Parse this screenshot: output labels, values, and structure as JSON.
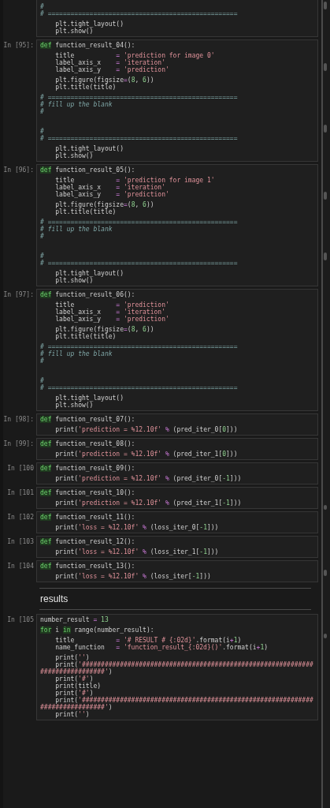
{
  "cells": [
    {
      "kind": "code",
      "cut_off_top": true,
      "lines": [
        {
          "kind": "code",
          "tokens": [
            {
              "kind": "comment",
              "text": "#"
            }
          ]
        },
        {
          "kind": "code",
          "tokens": [
            {
              "kind": "comment",
              "text": "# =================================================="
            }
          ]
        },
        {
          "kind": "blank"
        },
        {
          "kind": "code",
          "tokens": [
            {
              "kind": "plain",
              "text": "    plt.tight_layout()"
            }
          ]
        },
        {
          "kind": "code",
          "tokens": [
            {
              "kind": "plain",
              "text": "    plt.show()"
            }
          ]
        }
      ]
    },
    {
      "kind": "code",
      "cut_off_top": false,
      "prompt": "In [95]:",
      "lines": [
        {
          "kind": "code",
          "tokens": [
            {
              "kind": "keyword",
              "text": "def"
            },
            {
              "kind": "plain",
              "text": " function_result_04():"
            }
          ]
        },
        {
          "kind": "blank"
        },
        {
          "kind": "code",
          "tokens": [
            {
              "kind": "plain",
              "text": "    title           "
            },
            {
              "kind": "operator",
              "text": "= "
            },
            {
              "kind": "string",
              "text": "'prediction for image 0'"
            }
          ]
        },
        {
          "kind": "code",
          "tokens": [
            {
              "kind": "plain",
              "text": "    label_axis_x    "
            },
            {
              "kind": "operator",
              "text": "= "
            },
            {
              "kind": "string",
              "text": "'iteration'"
            }
          ]
        },
        {
          "kind": "code",
          "tokens": [
            {
              "kind": "plain",
              "text": "    label_axis_y    "
            },
            {
              "kind": "operator",
              "text": "= "
            },
            {
              "kind": "string",
              "text": "'prediction'"
            }
          ]
        },
        {
          "kind": "blank"
        },
        {
          "kind": "code",
          "tokens": [
            {
              "kind": "plain",
              "text": "    plt.figure(figsize"
            },
            {
              "kind": "operator",
              "text": "="
            },
            {
              "kind": "plain",
              "text": "("
            },
            {
              "kind": "number",
              "text": "8"
            },
            {
              "kind": "plain",
              "text": ", "
            },
            {
              "kind": "number",
              "text": "6"
            },
            {
              "kind": "plain",
              "text": "))"
            }
          ]
        },
        {
          "kind": "code",
          "tokens": [
            {
              "kind": "plain",
              "text": "    plt.title(title)"
            }
          ]
        },
        {
          "kind": "blank"
        },
        {
          "kind": "code",
          "tokens": [
            {
              "kind": "comment",
              "text": "# =================================================="
            }
          ]
        },
        {
          "kind": "code",
          "tokens": [
            {
              "kind": "comment",
              "text": "# fill up the blank"
            }
          ]
        },
        {
          "kind": "code",
          "tokens": [
            {
              "kind": "comment",
              "text": "#"
            }
          ]
        },
        {
          "kind": "blank"
        },
        {
          "kind": "blank"
        },
        {
          "kind": "blank"
        },
        {
          "kind": "blank"
        },
        {
          "kind": "code",
          "tokens": [
            {
              "kind": "comment",
              "text": "#"
            }
          ]
        },
        {
          "kind": "code",
          "tokens": [
            {
              "kind": "comment",
              "text": "# =================================================="
            }
          ]
        },
        {
          "kind": "blank"
        },
        {
          "kind": "code",
          "tokens": [
            {
              "kind": "plain",
              "text": "    plt.tight_layout()"
            }
          ]
        },
        {
          "kind": "code",
          "tokens": [
            {
              "kind": "plain",
              "text": "    plt.show()"
            }
          ]
        }
      ]
    },
    {
      "kind": "code",
      "cut_off_top": false,
      "prompt": "In [96]:",
      "lines": [
        {
          "kind": "code",
          "tokens": [
            {
              "kind": "keyword",
              "text": "def"
            },
            {
              "kind": "plain",
              "text": " function_result_05():"
            }
          ]
        },
        {
          "kind": "blank"
        },
        {
          "kind": "code",
          "tokens": [
            {
              "kind": "plain",
              "text": "    title           "
            },
            {
              "kind": "operator",
              "text": "= "
            },
            {
              "kind": "string",
              "text": "'prediction for image 1'"
            }
          ]
        },
        {
          "kind": "code",
          "tokens": [
            {
              "kind": "plain",
              "text": "    label_axis_x    "
            },
            {
              "kind": "operator",
              "text": "= "
            },
            {
              "kind": "string",
              "text": "'iteration'"
            }
          ]
        },
        {
          "kind": "code",
          "tokens": [
            {
              "kind": "plain",
              "text": "    label_axis_y    "
            },
            {
              "kind": "operator",
              "text": "= "
            },
            {
              "kind": "string",
              "text": "'prediction'"
            }
          ]
        },
        {
          "kind": "blank"
        },
        {
          "kind": "code",
          "tokens": [
            {
              "kind": "plain",
              "text": "    plt.figure(figsize"
            },
            {
              "kind": "operator",
              "text": "="
            },
            {
              "kind": "plain",
              "text": "("
            },
            {
              "kind": "number",
              "text": "8"
            },
            {
              "kind": "plain",
              "text": ", "
            },
            {
              "kind": "number",
              "text": "6"
            },
            {
              "kind": "plain",
              "text": "))"
            }
          ]
        },
        {
          "kind": "code",
          "tokens": [
            {
              "kind": "plain",
              "text": "    plt.title(title)"
            }
          ]
        },
        {
          "kind": "blank"
        },
        {
          "kind": "code",
          "tokens": [
            {
              "kind": "comment",
              "text": "# =================================================="
            }
          ]
        },
        {
          "kind": "code",
          "tokens": [
            {
              "kind": "comment",
              "text": "# fill up the blank"
            }
          ]
        },
        {
          "kind": "code",
          "tokens": [
            {
              "kind": "comment",
              "text": "#"
            }
          ]
        },
        {
          "kind": "blank"
        },
        {
          "kind": "blank"
        },
        {
          "kind": "blank"
        },
        {
          "kind": "blank"
        },
        {
          "kind": "code",
          "tokens": [
            {
              "kind": "comment",
              "text": "#"
            }
          ]
        },
        {
          "kind": "code",
          "tokens": [
            {
              "kind": "comment",
              "text": "# =================================================="
            }
          ]
        },
        {
          "kind": "blank"
        },
        {
          "kind": "code",
          "tokens": [
            {
              "kind": "plain",
              "text": "    plt.tight_layout()"
            }
          ]
        },
        {
          "kind": "code",
          "tokens": [
            {
              "kind": "plain",
              "text": "    plt.show()"
            }
          ]
        }
      ]
    },
    {
      "kind": "code",
      "cut_off_top": false,
      "prompt": "In [97]:",
      "lines": [
        {
          "kind": "code",
          "tokens": [
            {
              "kind": "keyword",
              "text": "def"
            },
            {
              "kind": "plain",
              "text": " function_result_06():"
            }
          ]
        },
        {
          "kind": "blank"
        },
        {
          "kind": "code",
          "tokens": [
            {
              "kind": "plain",
              "text": "    title           "
            },
            {
              "kind": "operator",
              "text": "= "
            },
            {
              "kind": "string",
              "text": "'prediction'"
            }
          ]
        },
        {
          "kind": "code",
          "tokens": [
            {
              "kind": "plain",
              "text": "    label_axis_x    "
            },
            {
              "kind": "operator",
              "text": "= "
            },
            {
              "kind": "string",
              "text": "'iteration'"
            }
          ]
        },
        {
          "kind": "code",
          "tokens": [
            {
              "kind": "plain",
              "text": "    label_axis_y    "
            },
            {
              "kind": "operator",
              "text": "= "
            },
            {
              "kind": "string",
              "text": "'prediction'"
            }
          ]
        },
        {
          "kind": "blank"
        },
        {
          "kind": "code",
          "tokens": [
            {
              "kind": "plain",
              "text": "    plt.figure(figsize"
            },
            {
              "kind": "operator",
              "text": "="
            },
            {
              "kind": "plain",
              "text": "("
            },
            {
              "kind": "number",
              "text": "8"
            },
            {
              "kind": "plain",
              "text": ", "
            },
            {
              "kind": "number",
              "text": "6"
            },
            {
              "kind": "plain",
              "text": "))"
            }
          ]
        },
        {
          "kind": "code",
          "tokens": [
            {
              "kind": "plain",
              "text": "    plt.title(title)"
            }
          ]
        },
        {
          "kind": "blank"
        },
        {
          "kind": "code",
          "tokens": [
            {
              "kind": "comment",
              "text": "# =================================================="
            }
          ]
        },
        {
          "kind": "code",
          "tokens": [
            {
              "kind": "comment",
              "text": "# fill up the blank"
            }
          ]
        },
        {
          "kind": "code",
          "tokens": [
            {
              "kind": "comment",
              "text": "#"
            }
          ]
        },
        {
          "kind": "blank"
        },
        {
          "kind": "blank"
        },
        {
          "kind": "blank"
        },
        {
          "kind": "blank"
        },
        {
          "kind": "code",
          "tokens": [
            {
              "kind": "comment",
              "text": "#"
            }
          ]
        },
        {
          "kind": "code",
          "tokens": [
            {
              "kind": "comment",
              "text": "# =================================================="
            }
          ]
        },
        {
          "kind": "blank"
        },
        {
          "kind": "code",
          "tokens": [
            {
              "kind": "plain",
              "text": "    plt.tight_layout()"
            }
          ]
        },
        {
          "kind": "code",
          "tokens": [
            {
              "kind": "plain",
              "text": "    plt.show()"
            }
          ]
        }
      ]
    },
    {
      "kind": "code",
      "cut_off_top": false,
      "prompt": "In [98]:",
      "lines": [
        {
          "kind": "code",
          "tokens": [
            {
              "kind": "keyword",
              "text": "def"
            },
            {
              "kind": "plain",
              "text": " function_result_07():"
            }
          ]
        },
        {
          "kind": "blank"
        },
        {
          "kind": "code",
          "tokens": [
            {
              "kind": "plain",
              "text": "    print("
            },
            {
              "kind": "string",
              "text": "'prediction = %12.10f'"
            },
            {
              "kind": "operator",
              "text": " %"
            },
            {
              "kind": "plain",
              "text": " (pred_iter_0["
            },
            {
              "kind": "number",
              "text": "0"
            },
            {
              "kind": "plain",
              "text": "]))"
            }
          ]
        }
      ]
    },
    {
      "kind": "code",
      "cut_off_top": false,
      "prompt": "In [99]:",
      "lines": [
        {
          "kind": "code",
          "tokens": [
            {
              "kind": "keyword",
              "text": "def"
            },
            {
              "kind": "plain",
              "text": " function_result_08():"
            }
          ]
        },
        {
          "kind": "blank"
        },
        {
          "kind": "code",
          "tokens": [
            {
              "kind": "plain",
              "text": "    print("
            },
            {
              "kind": "string",
              "text": "'prediction = %12.10f'"
            },
            {
              "kind": "operator",
              "text": " %"
            },
            {
              "kind": "plain",
              "text": " (pred_iter_1["
            },
            {
              "kind": "number",
              "text": "0"
            },
            {
              "kind": "plain",
              "text": "]))"
            }
          ]
        }
      ]
    },
    {
      "kind": "code",
      "cut_off_top": false,
      "prompt": "In [100",
      "lines": [
        {
          "kind": "code",
          "tokens": [
            {
              "kind": "keyword",
              "text": "def"
            },
            {
              "kind": "plain",
              "text": " function_result_09():"
            }
          ]
        },
        {
          "kind": "blank"
        },
        {
          "kind": "code",
          "tokens": [
            {
              "kind": "plain",
              "text": "    print("
            },
            {
              "kind": "string",
              "text": "'prediction = %12.10f'"
            },
            {
              "kind": "operator",
              "text": " %"
            },
            {
              "kind": "plain",
              "text": " (pred_iter_0["
            },
            {
              "kind": "number",
              "text": "-1"
            },
            {
              "kind": "plain",
              "text": "]))"
            }
          ]
        }
      ]
    },
    {
      "kind": "code",
      "cut_off_top": false,
      "prompt": "In [101",
      "lines": [
        {
          "kind": "code",
          "tokens": [
            {
              "kind": "keyword",
              "text": "def"
            },
            {
              "kind": "plain",
              "text": " function_result_10():"
            }
          ]
        },
        {
          "kind": "blank"
        },
        {
          "kind": "code",
          "tokens": [
            {
              "kind": "plain",
              "text": "    print("
            },
            {
              "kind": "string",
              "text": "'prediction = %12.10f'"
            },
            {
              "kind": "operator",
              "text": " %"
            },
            {
              "kind": "plain",
              "text": " (pred_iter_1["
            },
            {
              "kind": "number",
              "text": "-1"
            },
            {
              "kind": "plain",
              "text": "]))"
            }
          ]
        }
      ]
    },
    {
      "kind": "code",
      "cut_off_top": false,
      "prompt": "In [102",
      "lines": [
        {
          "kind": "code",
          "tokens": [
            {
              "kind": "keyword",
              "text": "def"
            },
            {
              "kind": "plain",
              "text": " function_result_11():"
            }
          ]
        },
        {
          "kind": "blank"
        },
        {
          "kind": "code",
          "tokens": [
            {
              "kind": "plain",
              "text": "    print("
            },
            {
              "kind": "string",
              "text": "'loss = %12.10f'"
            },
            {
              "kind": "operator",
              "text": " %"
            },
            {
              "kind": "plain",
              "text": " (loss_iter_0["
            },
            {
              "kind": "number",
              "text": "-1"
            },
            {
              "kind": "plain",
              "text": "]))"
            }
          ]
        }
      ]
    },
    {
      "kind": "code",
      "cut_off_top": false,
      "prompt": "In [103",
      "lines": [
        {
          "kind": "code",
          "tokens": [
            {
              "kind": "keyword",
              "text": "def"
            },
            {
              "kind": "plain",
              "text": " function_result_12():"
            }
          ]
        },
        {
          "kind": "blank"
        },
        {
          "kind": "code",
          "tokens": [
            {
              "kind": "plain",
              "text": "    print("
            },
            {
              "kind": "string",
              "text": "'loss = %12.10f'"
            },
            {
              "kind": "operator",
              "text": " %"
            },
            {
              "kind": "plain",
              "text": " (loss_iter_1["
            },
            {
              "kind": "number",
              "text": "-1"
            },
            {
              "kind": "plain",
              "text": "]))"
            }
          ]
        }
      ]
    },
    {
      "kind": "code",
      "cut_off_top": false,
      "prompt": "In [104",
      "lines": [
        {
          "kind": "code",
          "tokens": [
            {
              "kind": "keyword",
              "text": "def"
            },
            {
              "kind": "plain",
              "text": " function_result_13():"
            }
          ]
        },
        {
          "kind": "blank"
        },
        {
          "kind": "code",
          "tokens": [
            {
              "kind": "plain",
              "text": "    print("
            },
            {
              "kind": "string",
              "text": "'loss = %12.10f'"
            },
            {
              "kind": "operator",
              "text": " %"
            },
            {
              "kind": "plain",
              "text": " (loss_iter["
            },
            {
              "kind": "number",
              "text": "-1"
            },
            {
              "kind": "plain",
              "text": "]))"
            }
          ]
        }
      ]
    },
    {
      "kind": "markdown",
      "heading": "results"
    },
    {
      "kind": "code",
      "cut_off_top": false,
      "prompt": "In [105",
      "lines": [
        {
          "kind": "code",
          "tokens": [
            {
              "kind": "plain",
              "text": "number_result "
            },
            {
              "kind": "operator",
              "text": "= "
            },
            {
              "kind": "number",
              "text": "13"
            }
          ]
        },
        {
          "kind": "blank"
        },
        {
          "kind": "code",
          "tokens": [
            {
              "kind": "keyword",
              "text": "for"
            },
            {
              "kind": "plain",
              "text": " i "
            },
            {
              "kind": "keyword",
              "text": "in"
            },
            {
              "kind": "plain",
              "text": " range(number_result):"
            }
          ]
        },
        {
          "kind": "blank"
        },
        {
          "kind": "code",
          "tokens": [
            {
              "kind": "plain",
              "text": "    title           "
            },
            {
              "kind": "operator",
              "text": "= "
            },
            {
              "kind": "string",
              "text": "'# RESULT # {:02d}'"
            },
            {
              "kind": "plain",
              "text": ".format(i"
            },
            {
              "kind": "operator",
              "text": "+"
            },
            {
              "kind": "number",
              "text": "1"
            },
            {
              "kind": "plain",
              "text": ")"
            }
          ]
        },
        {
          "kind": "code",
          "tokens": [
            {
              "kind": "plain",
              "text": "    name_function   "
            },
            {
              "kind": "operator",
              "text": "= "
            },
            {
              "kind": "string",
              "text": "'function_result_{:02d}()'"
            },
            {
              "kind": "plain",
              "text": ".format(i"
            },
            {
              "kind": "operator",
              "text": "+"
            },
            {
              "kind": "number",
              "text": "1"
            },
            {
              "kind": "plain",
              "text": ")"
            }
          ]
        },
        {
          "kind": "blank"
        },
        {
          "kind": "code",
          "tokens": [
            {
              "kind": "plain",
              "text": "    print("
            },
            {
              "kind": "string",
              "text": "''"
            },
            {
              "kind": "plain",
              "text": ")"
            }
          ]
        },
        {
          "kind": "code",
          "tokens": [
            {
              "kind": "plain",
              "text": "    print("
            },
            {
              "kind": "string",
              "text": "'##############################################################################'"
            },
            {
              "kind": "plain",
              "text": ")"
            }
          ]
        },
        {
          "kind": "code",
          "tokens": [
            {
              "kind": "plain",
              "text": "    print("
            },
            {
              "kind": "string",
              "text": "'#'"
            },
            {
              "kind": "plain",
              "text": ")"
            }
          ]
        },
        {
          "kind": "code",
          "tokens": [
            {
              "kind": "plain",
              "text": "    print(title)"
            }
          ]
        },
        {
          "kind": "code",
          "tokens": [
            {
              "kind": "plain",
              "text": "    print("
            },
            {
              "kind": "string",
              "text": "'#'"
            },
            {
              "kind": "plain",
              "text": ")"
            }
          ]
        },
        {
          "kind": "code",
          "tokens": [
            {
              "kind": "plain",
              "text": "    print("
            },
            {
              "kind": "string",
              "text": "'##############################################################################'"
            },
            {
              "kind": "plain",
              "text": ")"
            }
          ]
        },
        {
          "kind": "code",
          "tokens": [
            {
              "kind": "plain",
              "text": "    print("
            },
            {
              "kind": "string",
              "text": "''"
            },
            {
              "kind": "plain",
              "text": ")"
            }
          ]
        }
      ]
    }
  ]
}
